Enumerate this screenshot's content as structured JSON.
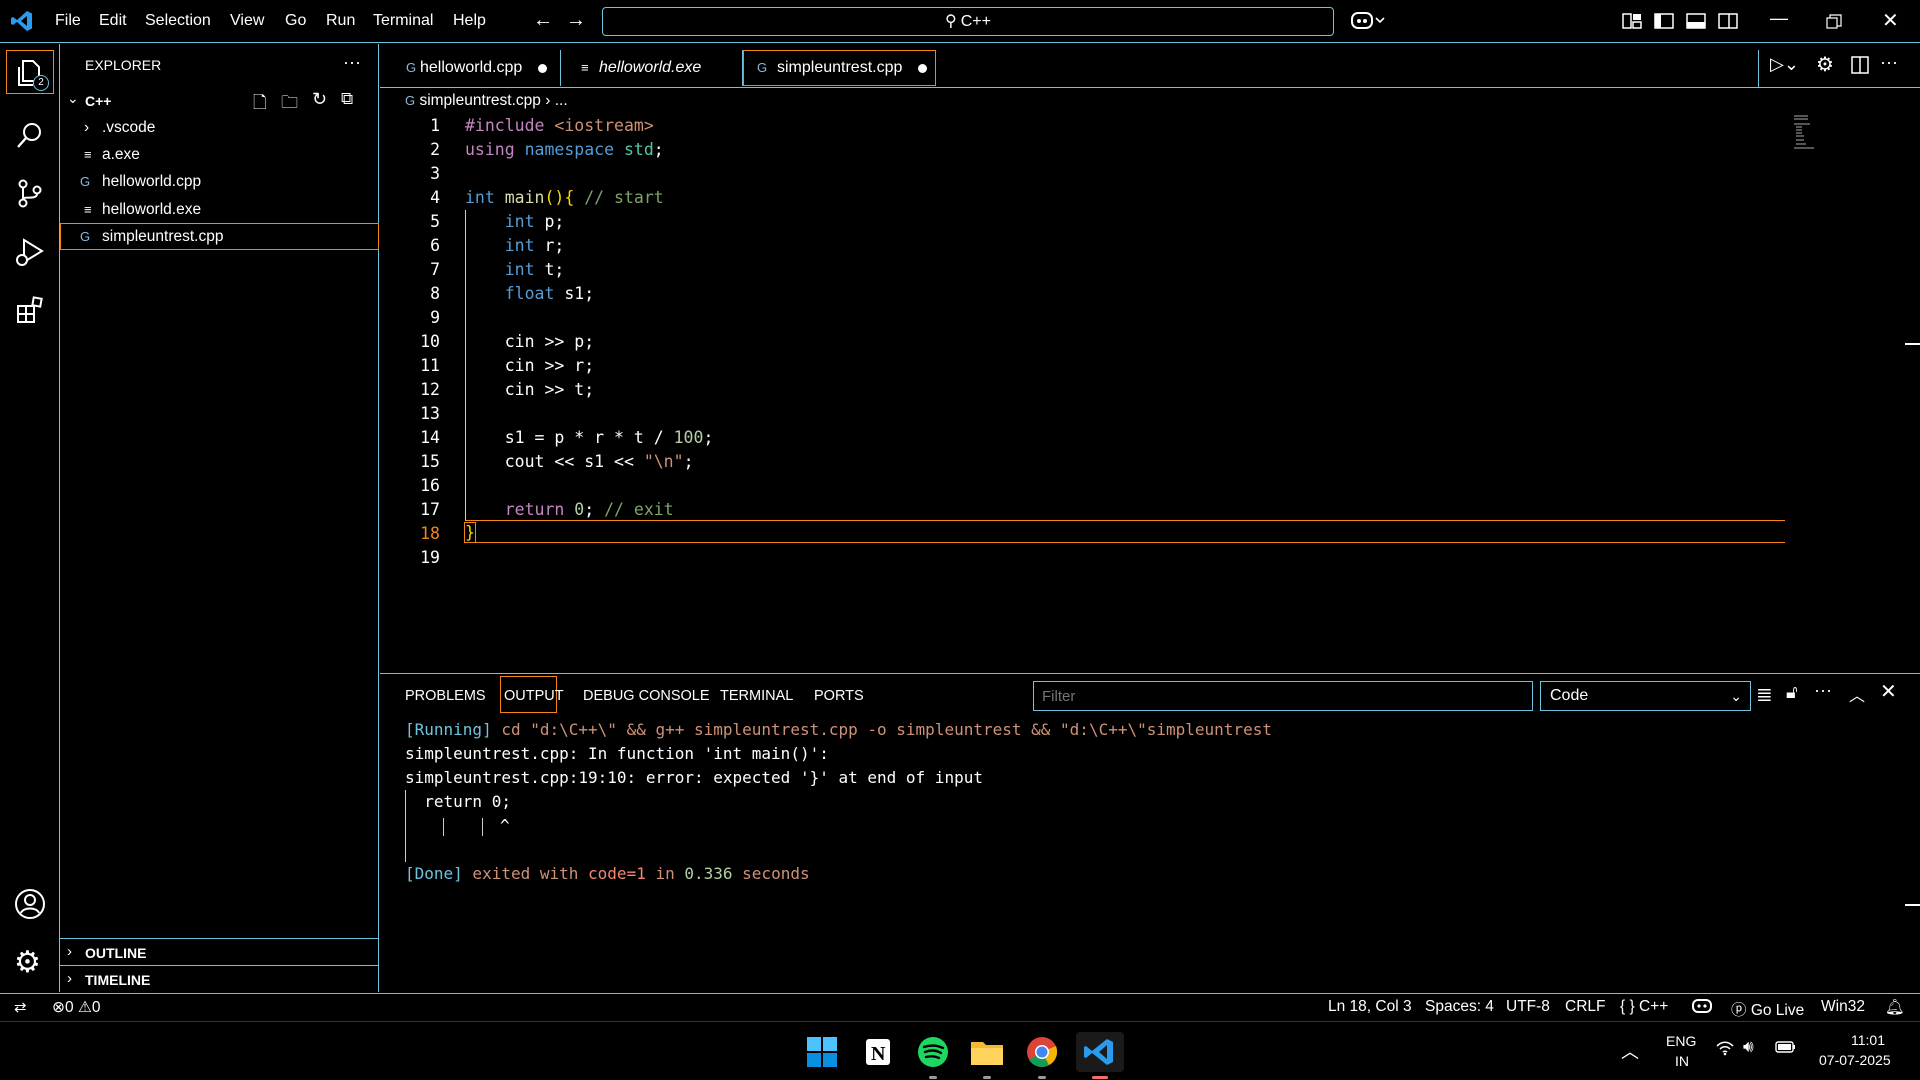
{
  "titlebar": {
    "menu": [
      "File",
      "Edit",
      "Selection",
      "View",
      "Go",
      "Run",
      "Terminal",
      "Help"
    ],
    "search_text": "C++"
  },
  "sidebar": {
    "title": "EXPLORER",
    "root": "C++",
    "items": [
      ".vscode",
      "a.exe",
      "helloworld.cpp",
      "helloworld.exe",
      "simpleuntrest.cpp"
    ],
    "outline": "OUTLINE",
    "timeline": "TIMELINE"
  },
  "activity": {
    "badge": "2"
  },
  "tabs": [
    {
      "label": "helloworld.cpp",
      "dirty": true
    },
    {
      "label": "helloworld.exe"
    },
    {
      "label": "simpleuntrest.cpp",
      "dirty": true,
      "active": true
    }
  ],
  "breadcrumb": {
    "file": "simpleuntrest.cpp",
    "rest": "..."
  },
  "code": {
    "l1a": "#include",
    "l1b": " <iostream>",
    "l2a": "using",
    "l2b": " namespace",
    "l2c": " std",
    ";": ";",
    "l4a": "int",
    "l4b": " main",
    "l4c": "(){",
    "l4d": " // start",
    "l5a": "    int",
    "l5b": " p;",
    "l6a": "    int",
    "l6b": " r;",
    "l7a": "    int",
    "l7b": " t;",
    "l8a": "    float",
    "l8b": " s1;",
    "l10": "    cin >> p;",
    "l11": "    cin >> r;",
    "l12": "    cin >> t;",
    "l14a": "    s1 = p * r * t / ",
    "l14b": "100",
    "l15a": "    cout << s1 << ",
    "l15b": "\"\\n\"",
    "l15c": ";",
    "l17a": "    return",
    "l17b": " 0",
    ";2": ";",
    "l17c": " // exit",
    "l18": "}"
  },
  "line_numbers": [
    "1",
    "2",
    "3",
    "4",
    "5",
    "6",
    "7",
    "8",
    "9",
    "10",
    "11",
    "12",
    "13",
    "14",
    "15",
    "16",
    "17",
    "18",
    "19"
  ],
  "panel": {
    "tabs": [
      "PROBLEMS",
      "OUTPUT",
      "DEBUG CONSOLE",
      "TERMINAL",
      "PORTS"
    ],
    "filter_placeholder": "Filter",
    "channel": "Code",
    "output": {
      "run_tag": "[Running]",
      "run_cmd": " cd \"d:\\C++\\\" && g++ simpleuntrest.cpp -o simpleuntrest && \"d:\\C++\\\"simpleuntrest",
      "l2": "simpleuntrest.cpp: In function 'int main()':",
      "l3": "simpleuntrest.cpp:19:10: error: expected '}' at end of input",
      "l4": "  return 0;",
      "l5": "^",
      "done_tag": "[Done]",
      "done_a": " exited with ",
      "done_code": "code=1",
      "done_b": " in ",
      "done_time": "0.336",
      "done_c": " seconds"
    }
  },
  "status": {
    "errors": "0",
    "warnings": "0",
    "position": "Ln 18, Col 3",
    "spaces": "Spaces: 4",
    "encoding": "UTF-8",
    "eol": "CRLF",
    "language": "{ } C++",
    "golive": "Go Live",
    "platform": "Win32"
  },
  "taskbar": {
    "lang1": "ENG",
    "lang2": "IN",
    "time": "11:01",
    "date": "07-07-2025"
  },
  "colors": {
    "contrast_border": "#6fc3df",
    "active_orange": "#f38518"
  }
}
